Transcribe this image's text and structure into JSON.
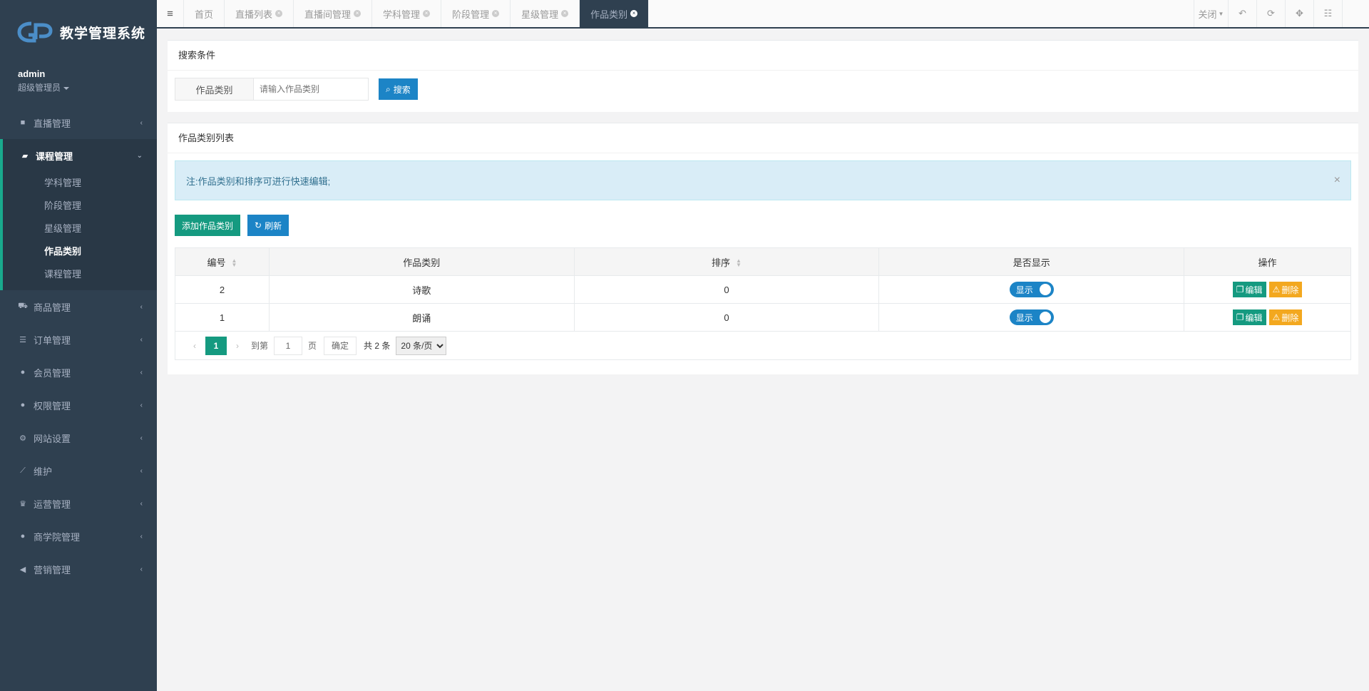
{
  "app": {
    "title": "教学管理系统",
    "brand_color": "#2f4050",
    "accent_color": "#1ab394"
  },
  "profile": {
    "name": "admin",
    "role": "超级管理员"
  },
  "nav": {
    "live": "直播管理",
    "course": "课程管理",
    "course_sub": [
      "学科管理",
      "阶段管理",
      "星级管理",
      "作品类别",
      "课程管理"
    ],
    "goods": "商品管理",
    "orders": "订单管理",
    "members": "会员管理",
    "permissions": "权限管理",
    "site": "网站设置",
    "maintain": "维护",
    "operation": "运营管理",
    "academy": "商学院管理",
    "marketing": "营销管理"
  },
  "tabs": [
    "首页",
    "直播列表",
    "直播间管理",
    "学科管理",
    "阶段管理",
    "星级管理",
    "作品类别"
  ],
  "topbar": {
    "close_label": "关闭"
  },
  "search": {
    "title": "搜索条件",
    "field_label": "作品类别",
    "placeholder": "请输入作品类别",
    "button": "搜索"
  },
  "list": {
    "title": "作品类别列表",
    "notice": "注:作品类别和排序可进行快速编辑;",
    "add_button": "添加作品类别",
    "refresh_button": "刷新",
    "columns": [
      "编号",
      "作品类别",
      "排序",
      "是否显示",
      "操作"
    ],
    "rows": [
      {
        "id": "2",
        "name": "诗歌",
        "sort": "0",
        "show": "显示"
      },
      {
        "id": "1",
        "name": "朗诵",
        "sort": "0",
        "show": "显示"
      }
    ],
    "edit_label": "编辑",
    "delete_label": "删除"
  },
  "pager": {
    "current": "1",
    "goto_label": "到第",
    "page_value": "1",
    "page_unit": "页",
    "confirm": "确定",
    "total": "共 2 条",
    "page_size": "20 条/页"
  }
}
